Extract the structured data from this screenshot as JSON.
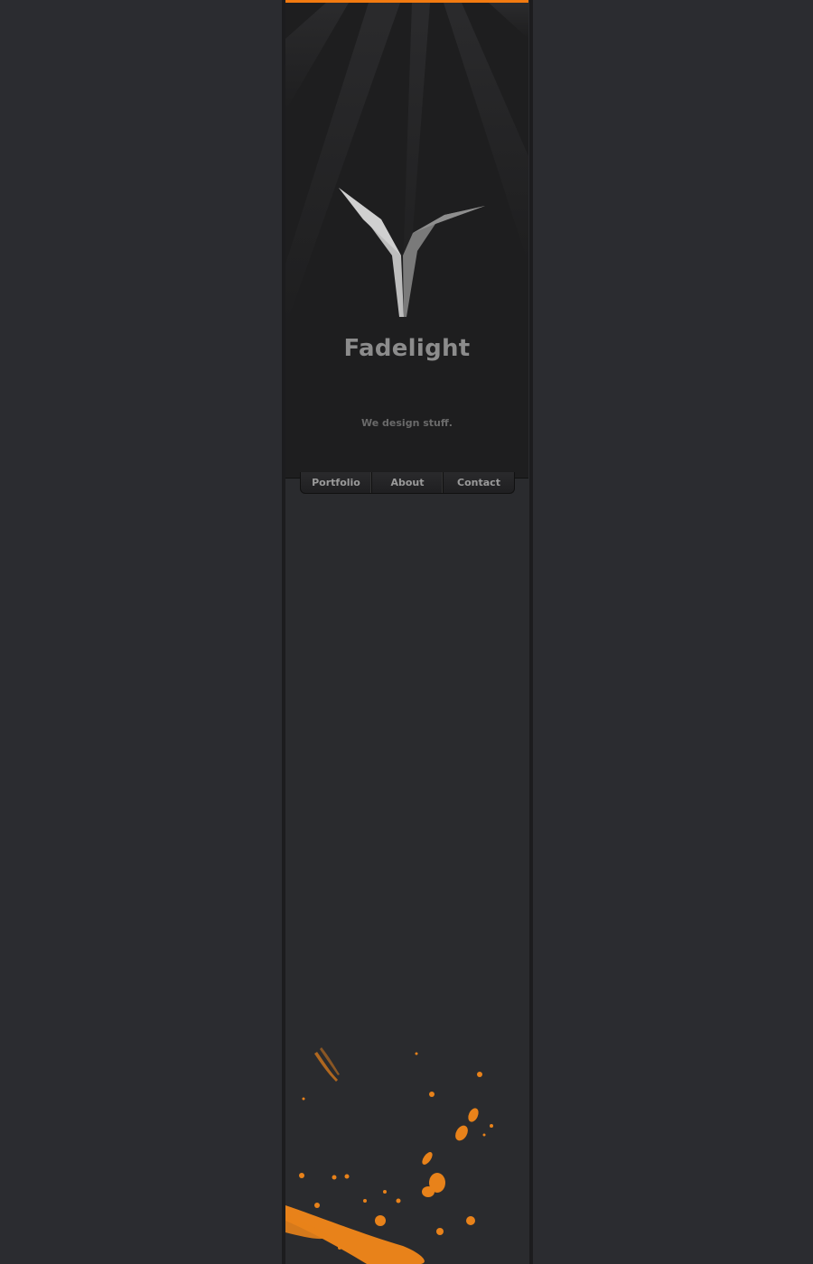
{
  "site": {
    "brand": "Fadelight",
    "tagline": "We design stuff."
  },
  "nav": {
    "items": [
      {
        "label": "Portfolio"
      },
      {
        "label": "About"
      },
      {
        "label": "Contact"
      }
    ]
  },
  "colors": {
    "accent": "#f27a10",
    "background": "#2b2c30",
    "header": "#1e1e1f"
  },
  "icons": {
    "logo": "fadelight-v-wings-logo"
  }
}
